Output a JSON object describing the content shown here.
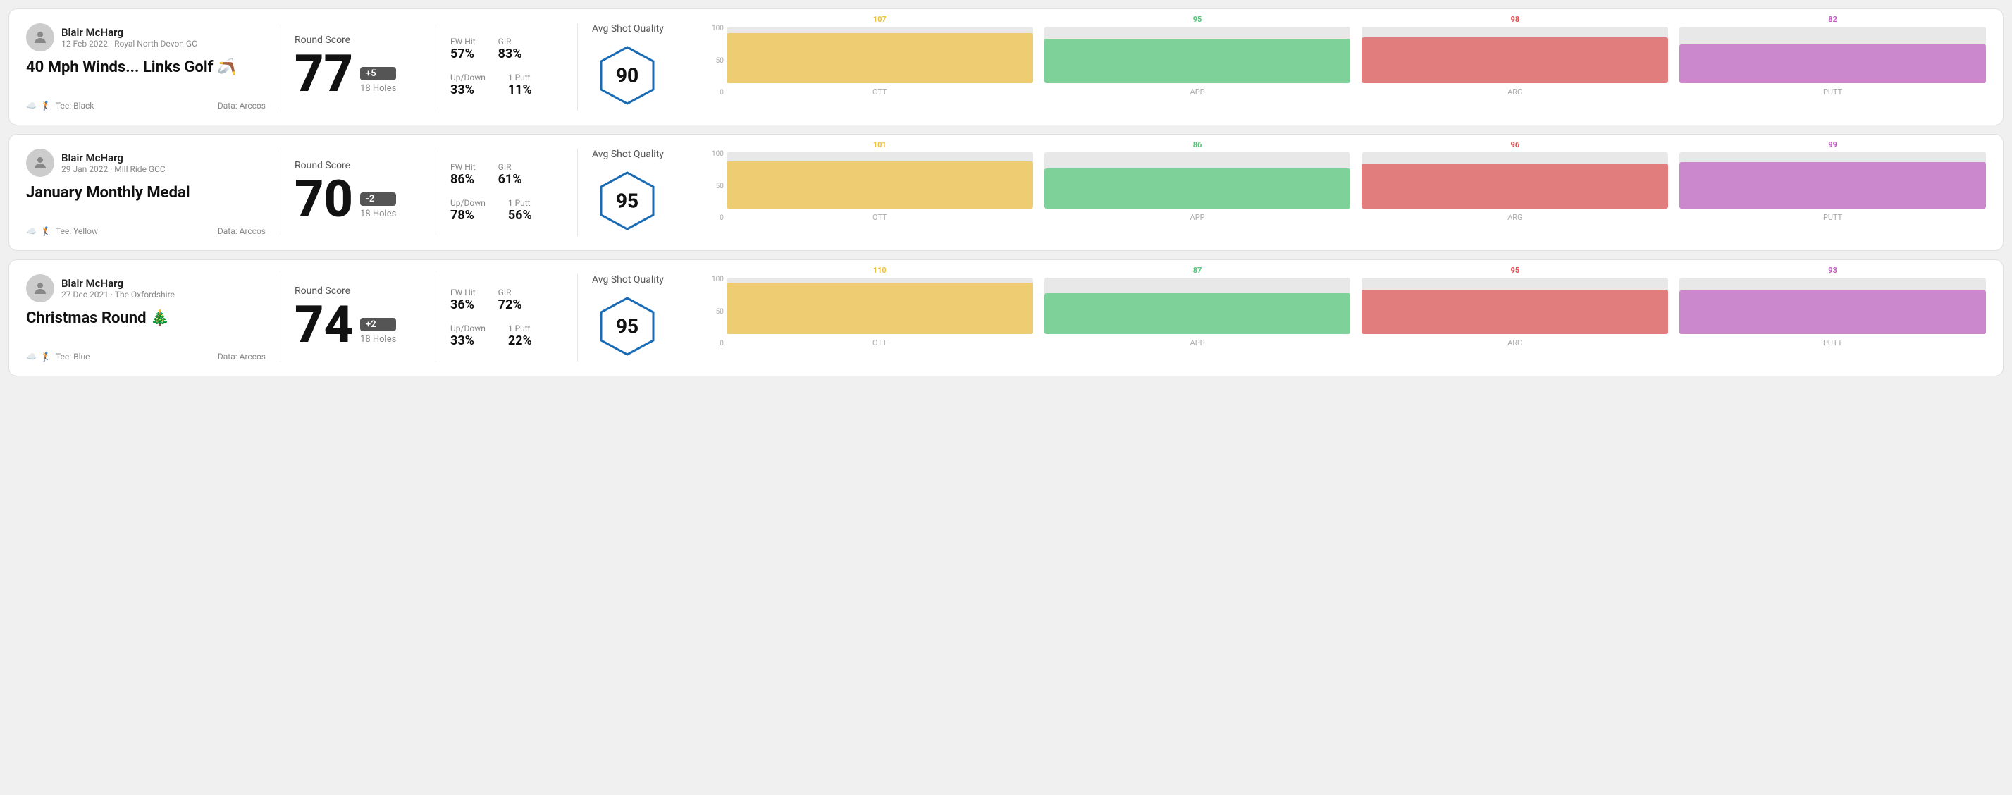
{
  "rounds": [
    {
      "id": "round-1",
      "player": "Blair McHarg",
      "date": "12 Feb 2022 · Royal North Devon GC",
      "title": "40 Mph Winds... Links Golf",
      "title_emoji": "🪃",
      "tee": "Black",
      "data_source": "Data: Arccos",
      "score": "77",
      "score_diff": "+5",
      "score_diff_type": "plus",
      "holes": "18 Holes",
      "fw_hit": "57%",
      "gir": "83%",
      "up_down": "33%",
      "one_putt": "11%",
      "avg_shot_quality": "90",
      "chart": {
        "bars": [
          {
            "label": "OTT",
            "value": 107,
            "max": 120,
            "color": "#f0c040"
          },
          {
            "label": "APP",
            "value": 95,
            "max": 120,
            "color": "#50c878"
          },
          {
            "label": "ARG",
            "value": 98,
            "max": 120,
            "color": "#e05050"
          },
          {
            "label": "PUTT",
            "value": 82,
            "max": 120,
            "color": "#c060c0"
          }
        ]
      }
    },
    {
      "id": "round-2",
      "player": "Blair McHarg",
      "date": "29 Jan 2022 · Mill Ride GCC",
      "title": "January Monthly Medal",
      "title_emoji": "",
      "tee": "Yellow",
      "data_source": "Data: Arccos",
      "score": "70",
      "score_diff": "-2",
      "score_diff_type": "minus",
      "holes": "18 Holes",
      "fw_hit": "86%",
      "gir": "61%",
      "up_down": "78%",
      "one_putt": "56%",
      "avg_shot_quality": "95",
      "chart": {
        "bars": [
          {
            "label": "OTT",
            "value": 101,
            "max": 120,
            "color": "#f0c040"
          },
          {
            "label": "APP",
            "value": 86,
            "max": 120,
            "color": "#50c878"
          },
          {
            "label": "ARG",
            "value": 96,
            "max": 120,
            "color": "#e05050"
          },
          {
            "label": "PUTT",
            "value": 99,
            "max": 120,
            "color": "#c060c0"
          }
        ]
      }
    },
    {
      "id": "round-3",
      "player": "Blair McHarg",
      "date": "27 Dec 2021 · The Oxfordshire",
      "title": "Christmas Round",
      "title_emoji": "🎄",
      "tee": "Blue",
      "data_source": "Data: Arccos",
      "score": "74",
      "score_diff": "+2",
      "score_diff_type": "plus",
      "holes": "18 Holes",
      "fw_hit": "36%",
      "gir": "72%",
      "up_down": "33%",
      "one_putt": "22%",
      "avg_shot_quality": "95",
      "chart": {
        "bars": [
          {
            "label": "OTT",
            "value": 110,
            "max": 120,
            "color": "#f0c040"
          },
          {
            "label": "APP",
            "value": 87,
            "max": 120,
            "color": "#50c878"
          },
          {
            "label": "ARG",
            "value": 95,
            "max": 120,
            "color": "#e05050"
          },
          {
            "label": "PUTT",
            "value": 93,
            "max": 120,
            "color": "#c060c0"
          }
        ]
      }
    }
  ],
  "labels": {
    "round_score": "Round Score",
    "fw_hit": "FW Hit",
    "gir": "GIR",
    "up_down": "Up/Down",
    "one_putt": "1 Putt",
    "avg_shot_quality": "Avg Shot Quality",
    "chart_y_100": "100",
    "chart_y_50": "50",
    "chart_y_0": "0"
  }
}
